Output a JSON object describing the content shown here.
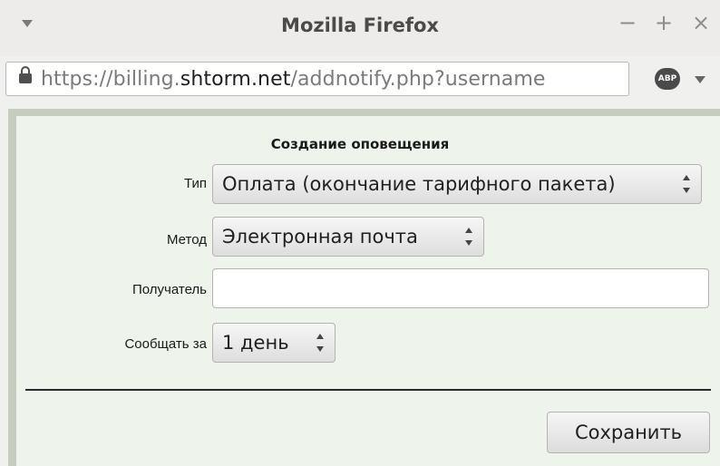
{
  "window": {
    "title": "Mozilla Firefox",
    "minimize": "−",
    "maximize": "+",
    "close": "×"
  },
  "urlbar": {
    "prefix": "https://billing.",
    "host": "shtorm.net",
    "path": "/addnotify.php?username"
  },
  "toolbar": {
    "abp_label": "ABP"
  },
  "form": {
    "title": "Создание оповещения",
    "type_label": "Тип",
    "type_value": "Оплата (окончание тарифного пакета)",
    "method_label": "Метод",
    "method_value": "Электронная почта",
    "recipient_label": "Получатель",
    "recipient_value": "",
    "notify_label": "Сообщать за",
    "notify_value": "1 день",
    "save_label": "Сохранить"
  }
}
